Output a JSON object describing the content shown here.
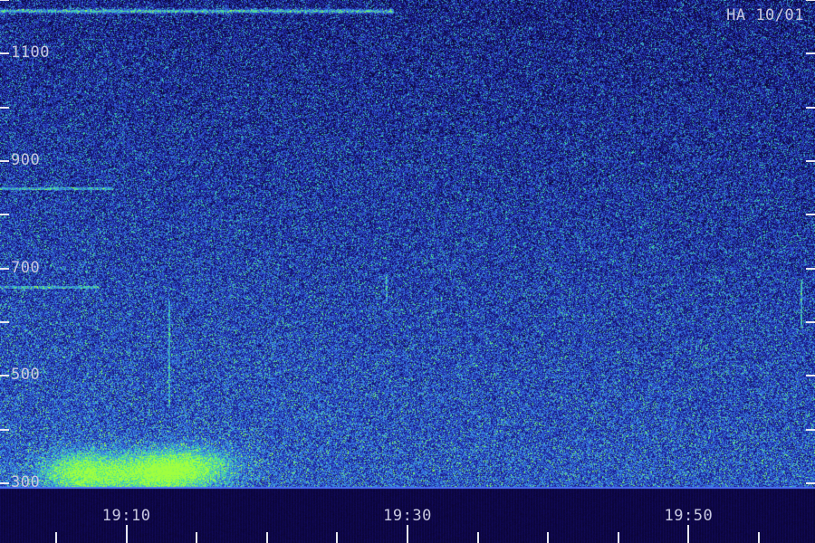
{
  "chart_data": {
    "type": "heatmap",
    "title": "HA 10/01",
    "xlabel": "",
    "ylabel": "",
    "x_ticks": [
      "19:10",
      "19:30",
      "19:50"
    ],
    "y_ticks": [
      300,
      500,
      700,
      900,
      1100
    ],
    "y_range": [
      290,
      1200
    ],
    "x_range_minutes": [
      1,
      59
    ],
    "minor_y_step": 100,
    "minor_x_step_minutes": 5,
    "colormap": [
      "#0a0530",
      "#1a1a8c",
      "#2f4fd0",
      "#3fa0e8",
      "#40e0a0",
      "#a0ff40"
    ],
    "grid": false,
    "legend": "none",
    "intensity_features": [
      {
        "kind": "band",
        "x_start": 1,
        "x_end": 29,
        "y": 1180,
        "level": 0.7
      },
      {
        "kind": "blob",
        "x": 7,
        "y": 320,
        "level": 0.9
      },
      {
        "kind": "blob",
        "x": 12,
        "y": 320,
        "level": 0.85
      },
      {
        "kind": "blob",
        "x": 15,
        "y": 330,
        "level": 0.6
      },
      {
        "kind": "hline",
        "x_start": 1,
        "x_end": 9,
        "y": 850,
        "level": 0.6
      },
      {
        "kind": "hline",
        "x_start": 1,
        "x_end": 8,
        "y": 665,
        "level": 0.55
      },
      {
        "kind": "vline",
        "x": 13,
        "y_start": 440,
        "y_end": 640,
        "level": 0.5
      },
      {
        "kind": "vline",
        "x": 28.5,
        "y_start": 640,
        "y_end": 690,
        "level": 0.6
      },
      {
        "kind": "vline",
        "x": 58,
        "y_start": 590,
        "y_end": 680,
        "level": 0.6
      }
    ]
  }
}
